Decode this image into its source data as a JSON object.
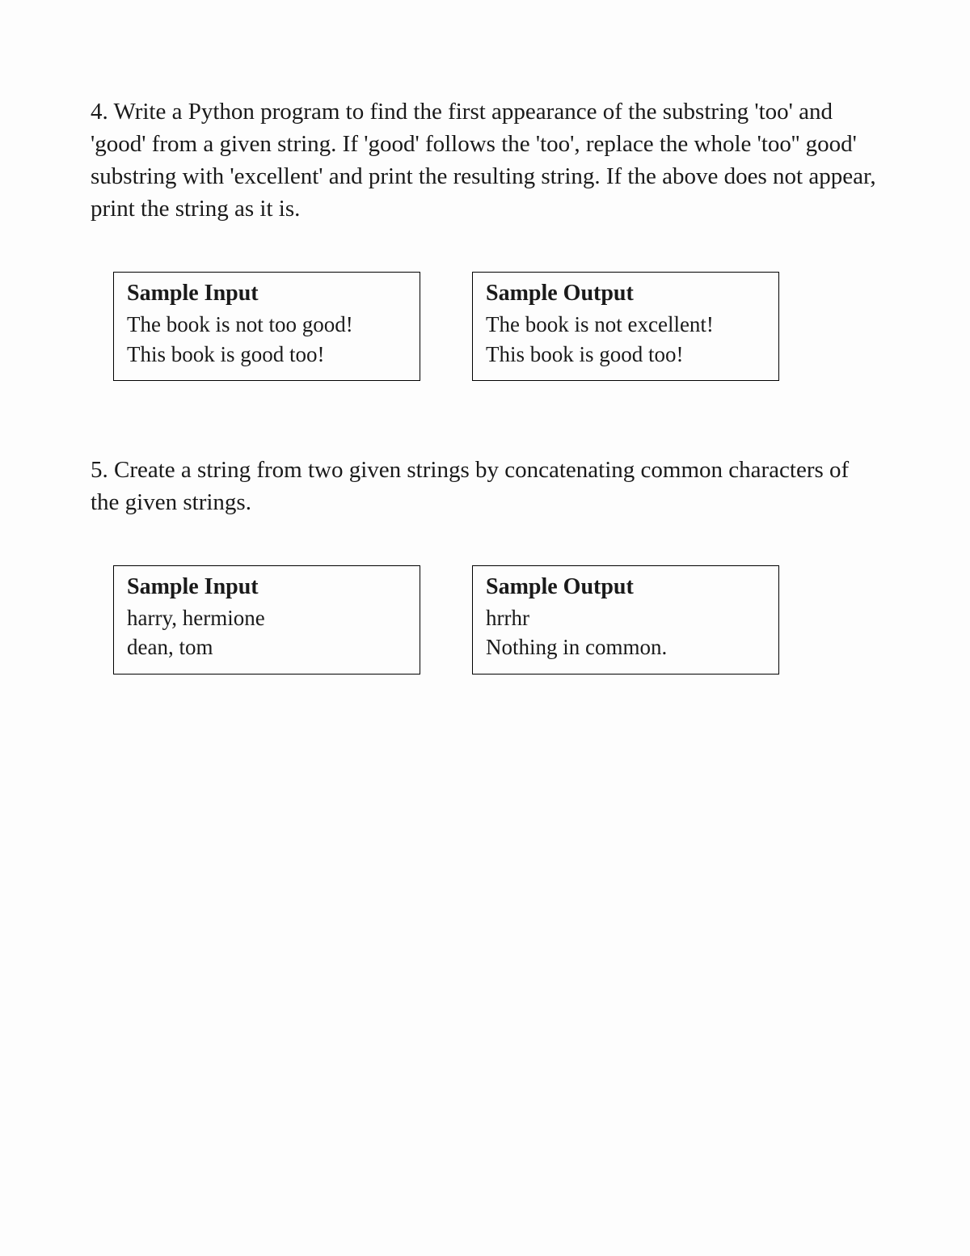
{
  "questions": [
    {
      "number": "4.",
      "text": "Write a Python program to find the first appearance of the substring 'too' and 'good' from a given string. If 'good' follows the 'too', replace the whole 'too'' good' substring with 'excellent' and print the resulting string. If the above does not appear, print the string as it is.",
      "input": {
        "heading": "Sample Input",
        "lines": [
          "The book is not too good!",
          "This book is good too!"
        ]
      },
      "output": {
        "heading": "Sample Output",
        "lines": [
          "The book is not excellent!",
          "This book is good too!"
        ]
      }
    },
    {
      "number": "5.",
      "text": "Create a string from two given strings by concatenating common characters of the given strings.",
      "input": {
        "heading": "Sample Input",
        "lines": [
          "harry, hermione",
          "dean, tom"
        ]
      },
      "output": {
        "heading": "Sample Output",
        "lines": [
          "hrrhr",
          "Nothing in common."
        ]
      }
    }
  ]
}
